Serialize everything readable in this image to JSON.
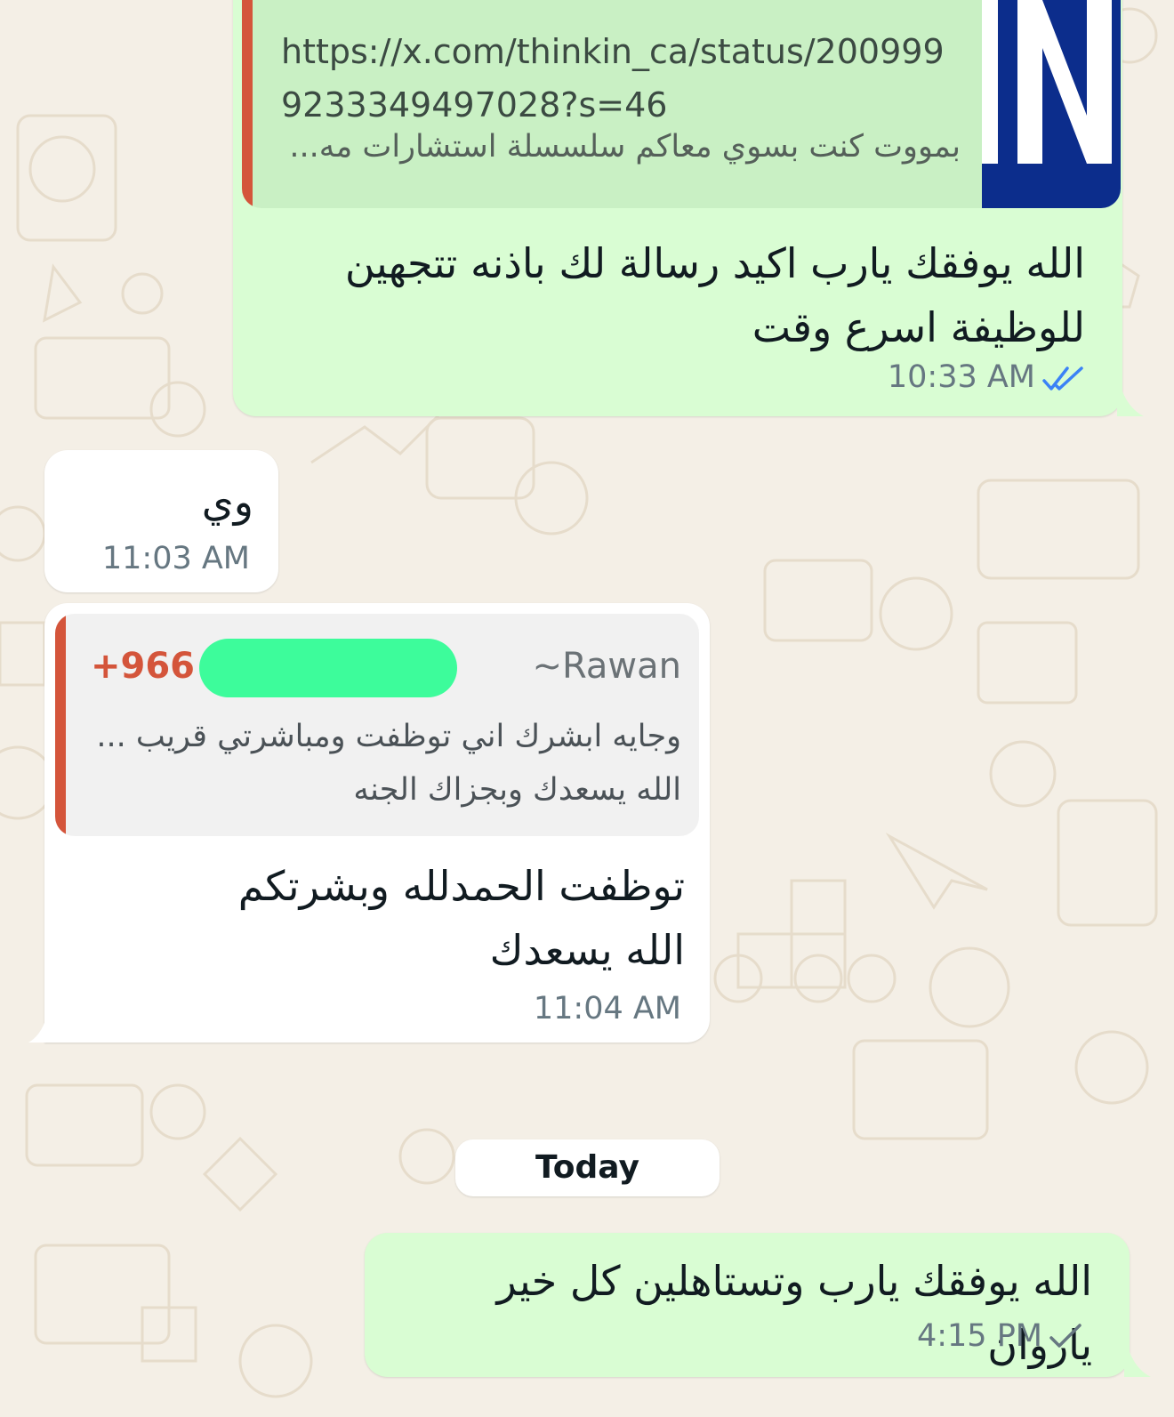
{
  "chat": {
    "messages": [
      {
        "direction": "outgoing",
        "link_preview": {
          "url": "https://x.com/thinkin_ca/status/2009999233349497028?s=46",
          "description": "بمووت كنت بسوي معاكم سلسسلة استشارات مه...",
          "thumb_text": "IN"
        },
        "text": "الله يوفقك يارب اكيد رسالة لك باذنه تتجهين للوظيفة اسرع وقت",
        "time": "10:33 AM",
        "status": "read"
      },
      {
        "direction": "incoming",
        "text": "وي",
        "time": "11:03 AM"
      },
      {
        "direction": "incoming",
        "quote": {
          "phone": "+966 5",
          "name": "~Rawan",
          "line1": "وجايه ابشرك اني توظفت ومباشرتي قريب ...",
          "line2": "الله يسعدك وبجزاك الجنه"
        },
        "text": "توظفت الحمدلله وبشرتكم الله يسعدك",
        "time": "11:04 AM"
      },
      {
        "direction": "outgoing",
        "text": "الله يوفقك يارب وتستاهلين كل خير ياروان",
        "time": "4:15 PM",
        "status": "sent"
      }
    ],
    "day_separator": "Today"
  },
  "colors": {
    "outgoing_bubble": "#d9fdd3",
    "incoming_bubble": "#ffffff",
    "quote_accent": "#d4553b",
    "read_ticks": "#3b82f6",
    "background": "#f4efe6",
    "redaction": "#3dfc9b"
  },
  "icons": [
    "double-check-read-icon",
    "single-check-icon"
  ]
}
